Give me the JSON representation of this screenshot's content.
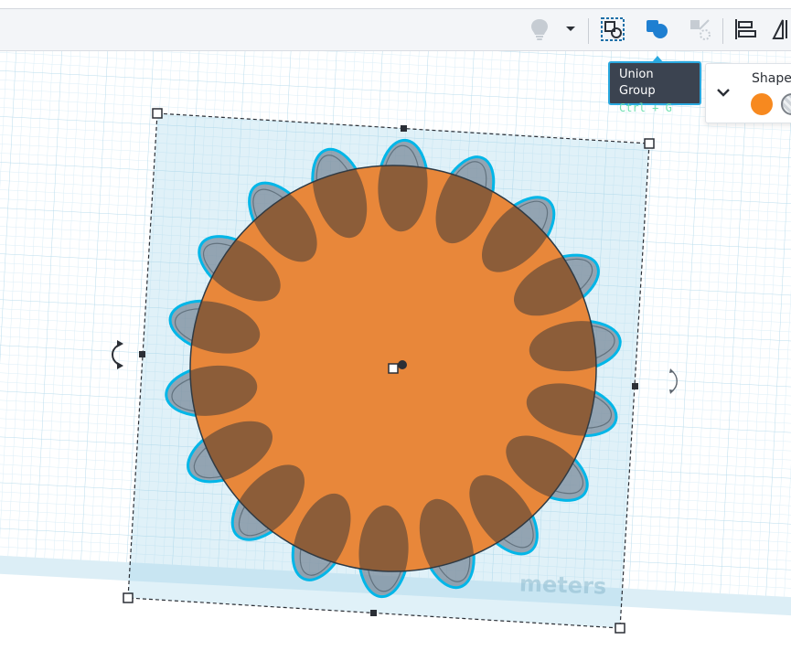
{
  "toolbar": {
    "icons": [
      "lightbulb-icon",
      "chevron-down-icon",
      "group-icon",
      "ungroup-icon",
      "align-icon",
      "mirror-icon"
    ]
  },
  "tooltip": {
    "title": "Union Group",
    "shortcut": "Ctrl + G"
  },
  "shape_panel": {
    "title": "Shape",
    "solid_color": "#f7891f"
  },
  "workplane": {
    "units_watermark": "meters",
    "grid_color": "#dbeef7"
  },
  "colors": {
    "accent": "#2aa9e0",
    "solid": "#e8873a",
    "hole": "#8d9aa8"
  }
}
